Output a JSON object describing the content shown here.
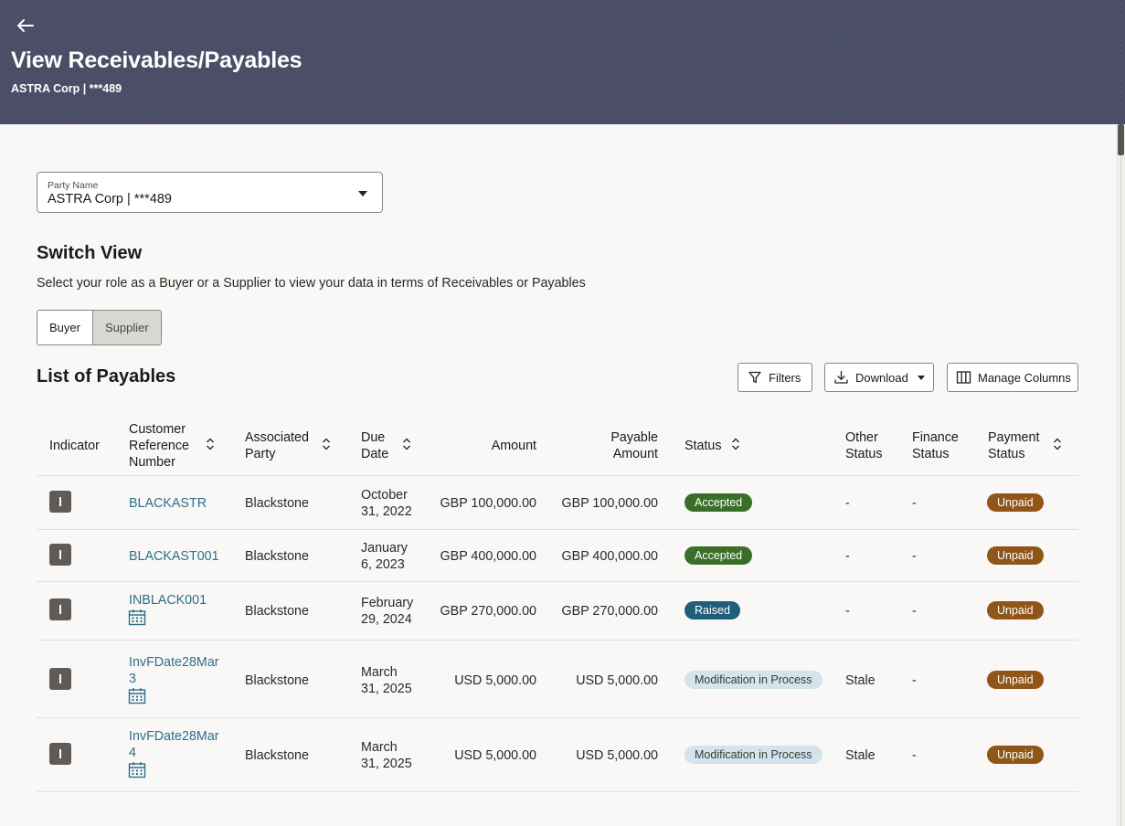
{
  "header": {
    "title": "View Receivables/Payables",
    "subtitle": "ASTRA Corp | ***489"
  },
  "party": {
    "label": "Party Name",
    "value": "ASTRA Corp | ***489"
  },
  "switch_view": {
    "title": "Switch View",
    "description": "Select your role as a Buyer or a Supplier to view your data in terms of Receivables or Payables",
    "options": [
      "Buyer",
      "Supplier"
    ],
    "selected": "Supplier"
  },
  "list": {
    "title": "List of Payables",
    "filters_label": "Filters",
    "download_label": "Download",
    "manage_label": "Manage Columns"
  },
  "table": {
    "columns": {
      "indicator": "Indicator",
      "ref": [
        "Customer",
        "Reference",
        "Number"
      ],
      "party": [
        "Associated",
        "Party"
      ],
      "due": [
        "Due",
        "Date"
      ],
      "amount": "Amount",
      "payable": [
        "Payable",
        "Amount"
      ],
      "status": "Status",
      "other": [
        "Other",
        "Status"
      ],
      "finance": [
        "Finance",
        "Status"
      ],
      "payment": [
        "Payment",
        "Status"
      ]
    },
    "rows": [
      {
        "ref": [
          "BLACKASTR"
        ],
        "party": "Blackstone",
        "due": [
          "October",
          "31, 2022"
        ],
        "amount": "GBP 100,000.00",
        "payable": "GBP 100,000.00",
        "status": "Accepted",
        "other": "-",
        "finance": "-",
        "payment": "Unpaid"
      },
      {
        "ref": [
          "BLACKAST001"
        ],
        "party": "Blackstone",
        "due": [
          "January",
          "6, 2023"
        ],
        "amount": "GBP 400,000.00",
        "payable": "GBP 400,000.00",
        "status": "Accepted",
        "other": "-",
        "finance": "-",
        "payment": "Unpaid"
      },
      {
        "ref": [
          "INBLACK001"
        ],
        "party": "Blackstone",
        "due": [
          "February",
          "29, 2024"
        ],
        "amount": "GBP 270,000.00",
        "payable": "GBP 270,000.00",
        "status": "Raised",
        "other": "-",
        "finance": "-",
        "payment": "Unpaid"
      },
      {
        "ref": [
          "InvFDate28Mar",
          "3"
        ],
        "party": "Blackstone",
        "due": [
          "March",
          "31, 2025"
        ],
        "amount": "USD 5,000.00",
        "payable": "USD 5,000.00",
        "status": "Modification in Process",
        "other": "Stale",
        "finance": "-",
        "payment": "Unpaid"
      },
      {
        "ref": [
          "InvFDate28Mar",
          "4"
        ],
        "party": "Blackstone",
        "due": [
          "March",
          "31, 2025"
        ],
        "amount": "USD 5,000.00",
        "payable": "USD 5,000.00",
        "status": "Modification in Process",
        "other": "Stale",
        "finance": "-",
        "payment": "Unpaid"
      }
    ]
  }
}
